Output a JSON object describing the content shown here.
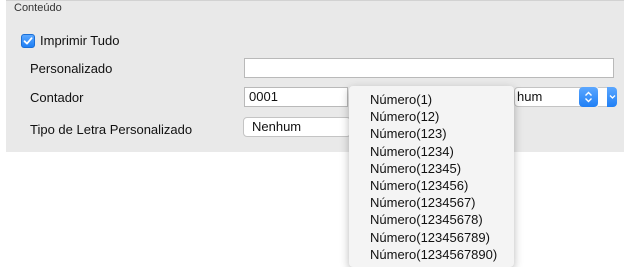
{
  "panel": {
    "title": "Conteúdo"
  },
  "print_all": {
    "label": "Imprimir Tudo",
    "checked": true
  },
  "custom": {
    "label": "Personalizado",
    "value": ""
  },
  "counter": {
    "label": "Contador",
    "value": "0001",
    "format_value": "",
    "type_value": "hum"
  },
  "font": {
    "label": "Tipo de Letra Personalizado",
    "value": "Nenhum"
  },
  "menu": {
    "items": [
      "Número(1)",
      "Número(12)",
      "Número(123)",
      "Número(1234)",
      "Número(12345)",
      "Número(123456)",
      "Número(1234567)",
      "Número(12345678)",
      "Número(123456789)",
      "Número(1234567890)"
    ]
  },
  "colors": {
    "accent": "#1f7ff5",
    "panel_bg": "#e9e9e9",
    "menu_bg": "#f4f4f4"
  },
  "icons": {
    "checkbox": "checkmark-icon",
    "stepper": "up-down-chevron-icon",
    "dropdown": "chevron-down-icon"
  }
}
